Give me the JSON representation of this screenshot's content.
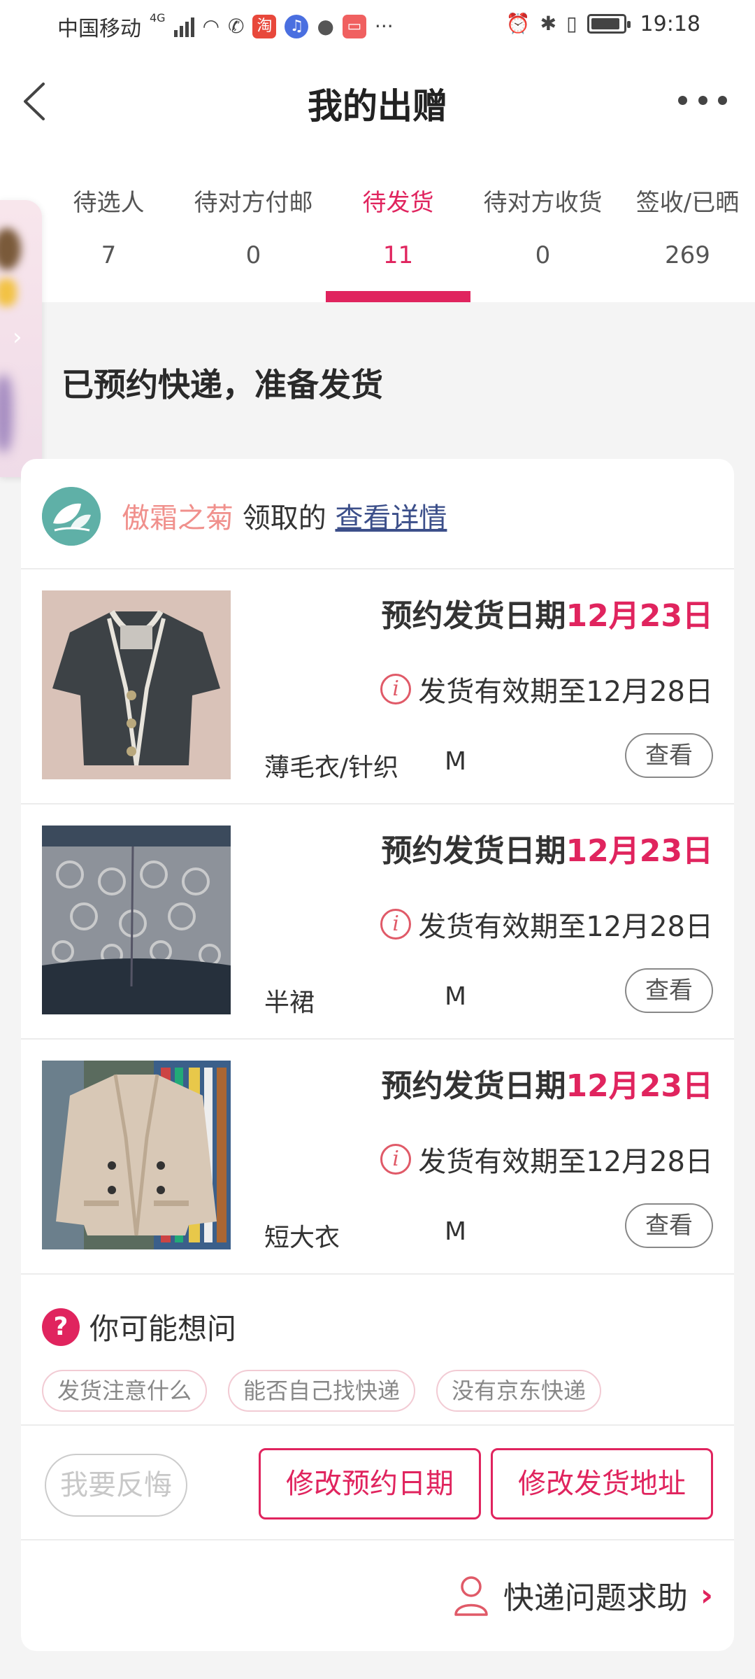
{
  "status_bar": {
    "carrier": "中国移动",
    "network": "4G",
    "time": "19:18"
  },
  "header": {
    "title": "我的出赠"
  },
  "tabs": [
    {
      "label": "待选人",
      "count": "7"
    },
    {
      "label": "待对方付邮",
      "count": "0"
    },
    {
      "label": "待发货",
      "count": "11"
    },
    {
      "label": "待对方收货",
      "count": "0"
    },
    {
      "label": "签收/已晒",
      "count": "269"
    }
  ],
  "section": {
    "heading": "已预约快递，准备发货"
  },
  "receiver": {
    "name": "傲霜之菊",
    "action_text": "领取的",
    "link_text": "查看详情"
  },
  "items": [
    {
      "date_label": "预约发货日期",
      "date_value": "12月23日",
      "valid_text": "发货有效期至12月28日",
      "category": "薄毛衣/针织",
      "size": "M",
      "view_label": "查看"
    },
    {
      "date_label": "预约发货日期",
      "date_value": "12月23日",
      "valid_text": "发货有效期至12月28日",
      "category": "半裙",
      "size": "M",
      "view_label": "查看"
    },
    {
      "date_label": "预约发货日期",
      "date_value": "12月23日",
      "valid_text": "发货有效期至12月28日",
      "category": "短大衣",
      "size": "M",
      "view_label": "查看"
    }
  ],
  "faq": {
    "title": "你可能想问",
    "icon_glyph": "?",
    "chips": [
      "发货注意什么",
      "能否自己找快递",
      "没有京东快递"
    ]
  },
  "actions": {
    "regret": "我要反悔",
    "change_date": "修改预约日期",
    "change_address": "修改发货地址"
  },
  "help": {
    "label": "快递问题求助"
  },
  "colors": {
    "accent": "#e0245e",
    "background": "#f4f4f4"
  }
}
